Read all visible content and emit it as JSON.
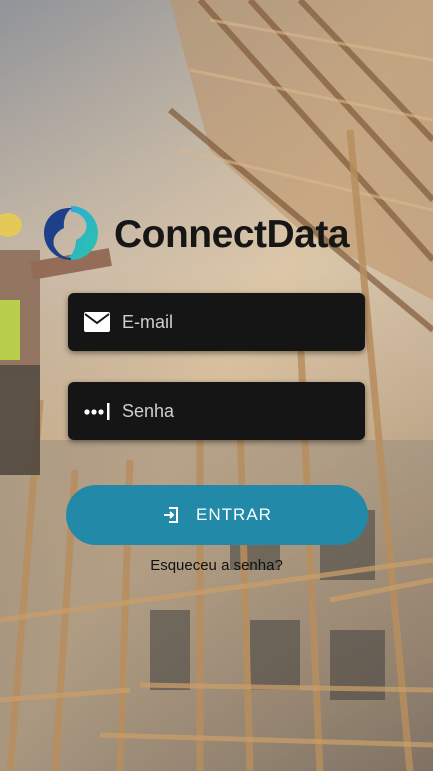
{
  "brand": {
    "name": "ConnectData",
    "icon": "connectdata-logo"
  },
  "login": {
    "email_placeholder": "E-mail",
    "email_icon": "envelope-icon",
    "password_placeholder": "Senha",
    "password_icon": "password-dots-icon",
    "submit_label": "ENTRAR",
    "submit_icon": "login-icon",
    "forgot_label": "Esqueceu a senha?"
  },
  "colors": {
    "accent": "#2289a8",
    "field_bg": "#151515",
    "logo_gradient_start": "#2aa9e0",
    "logo_gradient_end": "#2ec4a5",
    "logo_dark": "#1e3f8a"
  }
}
